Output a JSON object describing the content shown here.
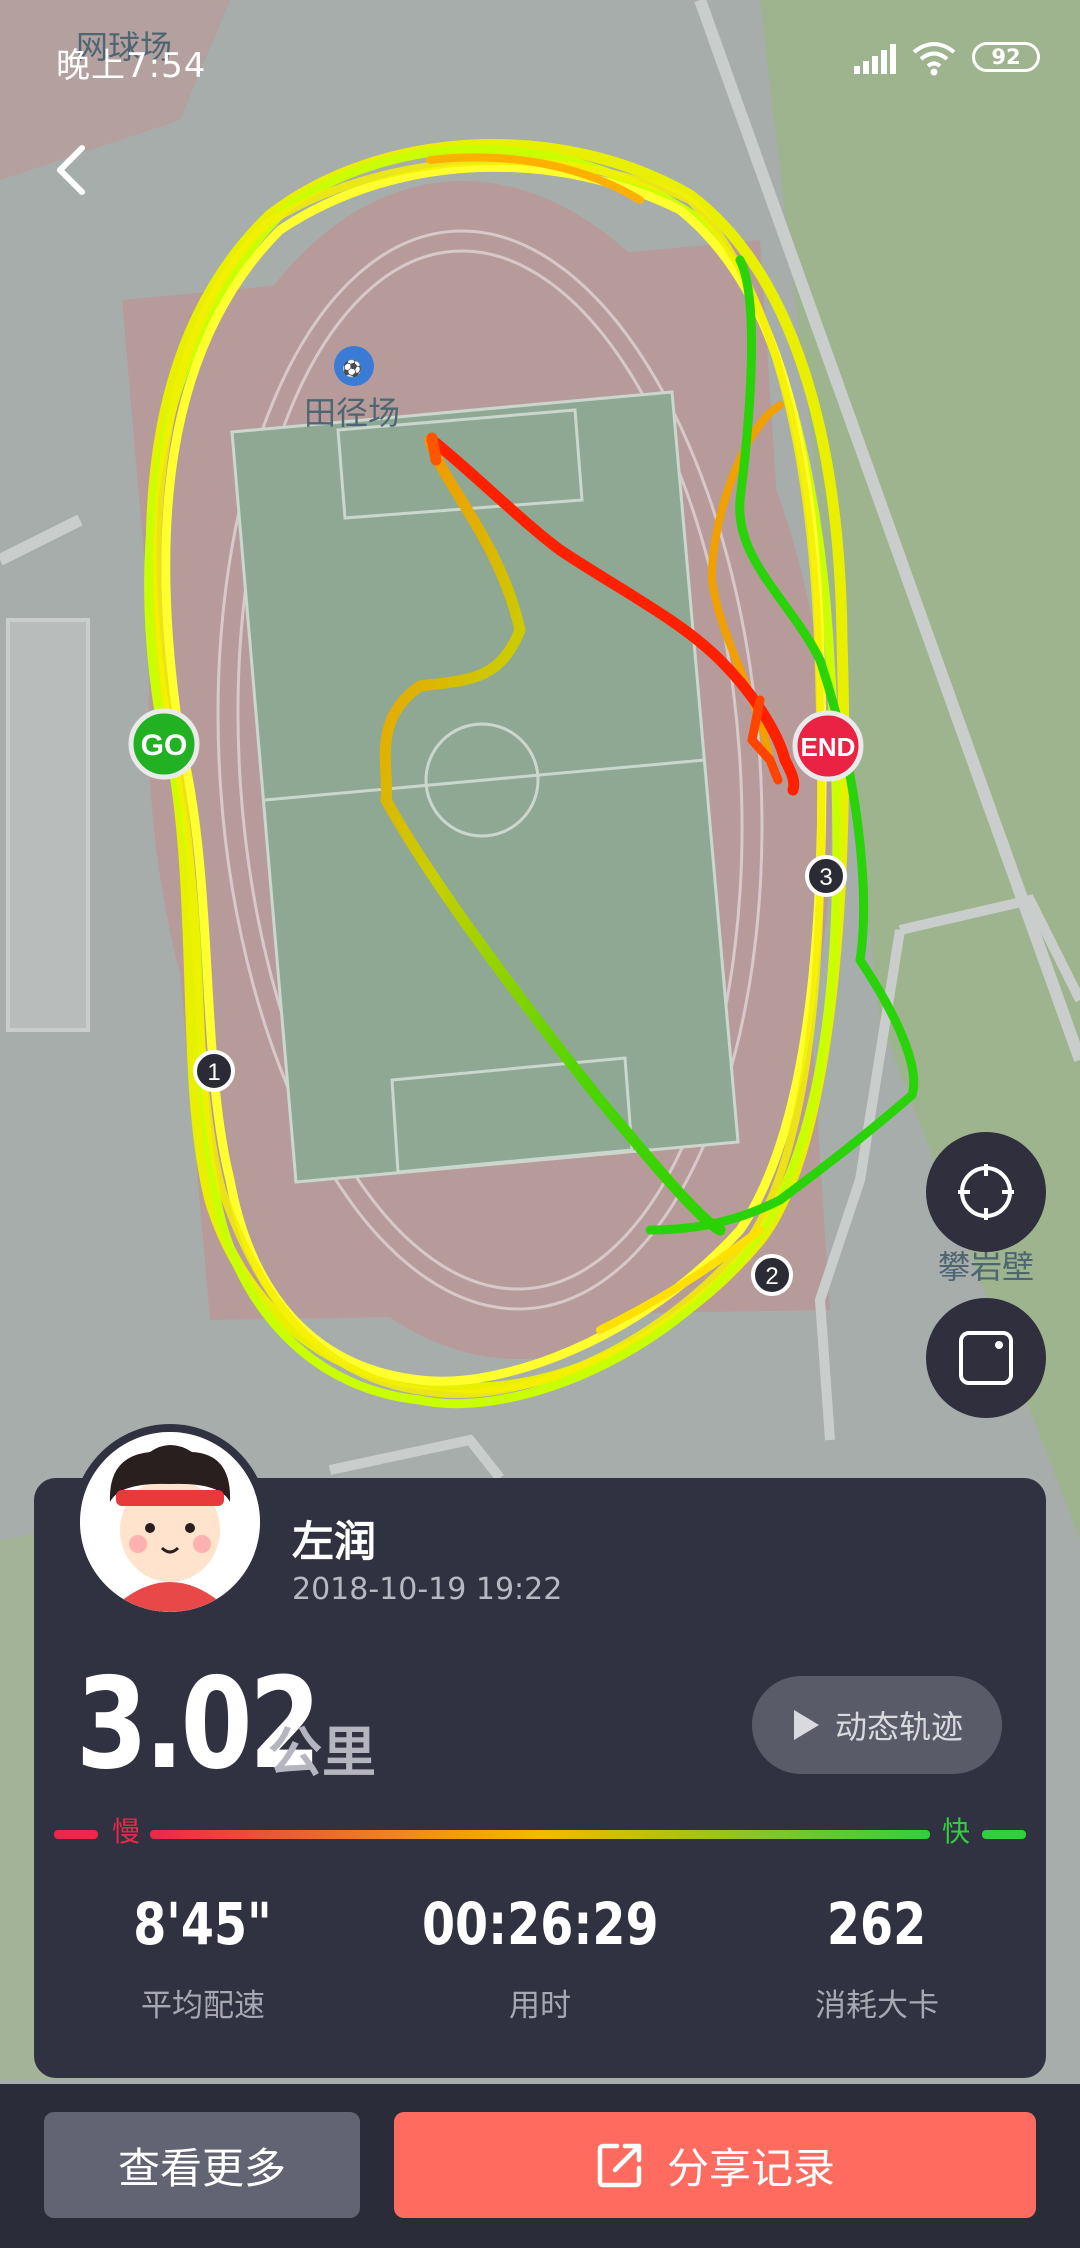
{
  "status_bar": {
    "time": "晚上7:54",
    "battery": "92"
  },
  "map": {
    "labels": {
      "tennis": "网球场",
      "field": "田径场",
      "climb": "攀岩壁"
    },
    "markers": {
      "start": "GO",
      "end": "END",
      "km1": "1",
      "km2": "2",
      "km3": "3"
    }
  },
  "user": {
    "name": "左润",
    "datetime": "2018-10-19 19:22"
  },
  "summary": {
    "distance": "3.02",
    "unit": "公里",
    "replay_label": "动态轨迹"
  },
  "pace_legend": {
    "slow": "慢",
    "fast": "快"
  },
  "stats": [
    {
      "value": "8'45\"",
      "label": "平均配速"
    },
    {
      "value": "00:26:29",
      "label": "用时"
    },
    {
      "value": "262",
      "label": "消耗大卡"
    }
  ],
  "actions": {
    "more": "查看更多",
    "share": "分享记录"
  },
  "colors": {
    "slow": "#e8294a",
    "fast": "#2fd03c",
    "share": "#ff6b5e",
    "card": "#313241"
  }
}
